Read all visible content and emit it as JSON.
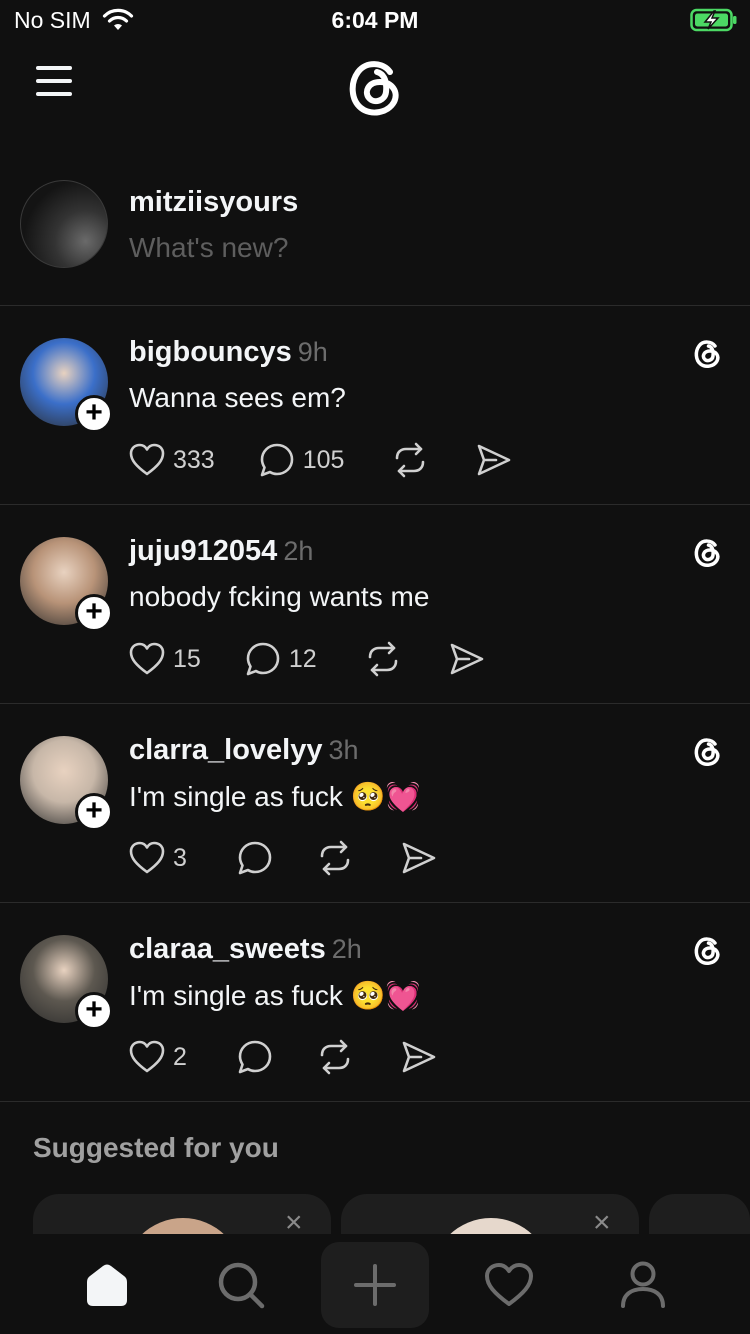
{
  "status": {
    "carrier": "No SIM",
    "time": "6:04 PM"
  },
  "composer": {
    "username": "mitziisyours",
    "placeholder": "What's new?"
  },
  "posts": [
    {
      "username": "bigbouncys",
      "ago": "9h",
      "text": "Wanna sees em?",
      "likes": "333",
      "replies": "105",
      "avatar_color": "#3b6fc9"
    },
    {
      "username": "juju912054",
      "ago": "2h",
      "text": "nobody fcking wants me",
      "likes": "15",
      "replies": "12",
      "avatar_color": "#b89378"
    },
    {
      "username": "clarra_lovelyy",
      "ago": "3h",
      "text": "I'm single as fuck 🥺💓",
      "likes": "3",
      "replies": "",
      "avatar_color": "#c7b7a8"
    },
    {
      "username": "claraa_sweets",
      "ago": "2h",
      "text": "I'm single as fuck 🥺💓",
      "likes": "2",
      "replies": "",
      "avatar_color": "#5d5850"
    }
  ],
  "suggested": {
    "title": "Suggested for you",
    "close_glyph": "×"
  },
  "icons": {
    "menu": "menu-icon",
    "logo": "threads-logo",
    "like": "heart-icon",
    "reply": "comment-icon",
    "repost": "repost-icon",
    "share": "send-icon",
    "home": "home-icon",
    "search": "search-icon",
    "compose": "plus-icon",
    "activity": "heart-icon",
    "profile": "person-icon"
  },
  "colors": {
    "background": "#101010",
    "text": "#f3f5f7",
    "muted": "#6c6c6c",
    "divider": "#2b2b2b",
    "battery": "#4cd964"
  }
}
